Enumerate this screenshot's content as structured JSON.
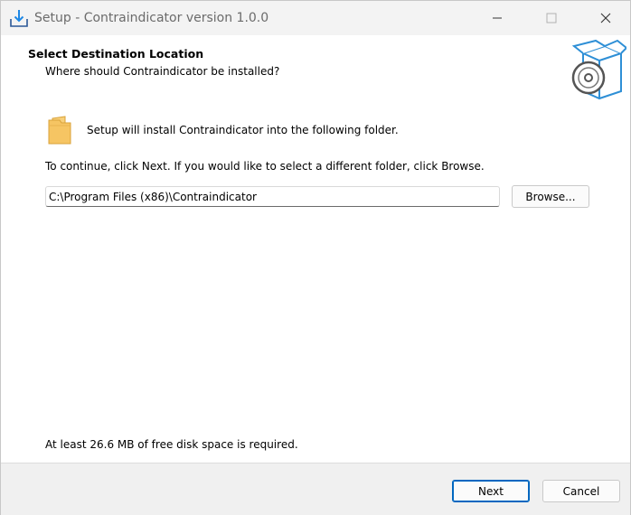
{
  "window": {
    "title": "Setup - Contraindicator version 1.0.0",
    "controls": [
      "minimize",
      "maximize",
      "close"
    ]
  },
  "header": {
    "title": "Select Destination Location",
    "subtitle": "Where should Contraindicator be installed?"
  },
  "content": {
    "info": "Setup will install Contraindicator into the following folder.",
    "continue": "To continue, click Next. If you would like to select a different folder, click Browse.",
    "path_value": "C:\\Program Files (x86)\\Contraindicator",
    "browse_label": "Browse...",
    "disk_space": "At least 26.6 MB of free disk space is required."
  },
  "footer": {
    "next_label": "Next",
    "cancel_label": "Cancel"
  },
  "icons": {
    "app": "installer-download-icon",
    "header": "box-disc-icon",
    "folder": "folder-icon"
  },
  "colors": {
    "accent": "#0067c0",
    "folder": "#f2b84b",
    "box_blue": "#2e8fd6"
  }
}
